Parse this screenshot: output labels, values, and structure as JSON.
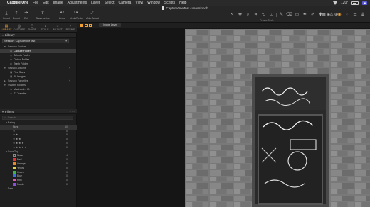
{
  "menubar": {
    "app": "Capture One",
    "items": [
      "File",
      "Edit",
      "Image",
      "Adjustments",
      "Layer",
      "Select",
      "Camera",
      "View",
      "Window",
      "Scripts",
      "Help"
    ],
    "user_badge": "",
    "battery": "120°"
  },
  "toolbar": {
    "document_title": "CaptureOneTest.cosessiondb",
    "left_tools": [
      {
        "label": "Import",
        "icon": "import-icon"
      },
      {
        "label": "Export",
        "icon": "export-icon"
      },
      {
        "label": "Exit",
        "icon": "exit-icon"
      },
      {
        "label": "Share online",
        "icon": "share-icon"
      },
      {
        "label": "Undo",
        "icon": "undo-icon"
      },
      {
        "label": "Undo/Redo",
        "icon": "redo-icon"
      },
      {
        "label": "Auto Adjust",
        "icon": "auto-adjust-icon"
      }
    ],
    "cursor_tools_label": "Cursor Tools"
  },
  "tool_tabs": [
    {
      "label": "LIBRARY",
      "active": true
    },
    {
      "label": "CAPTURE",
      "active": false
    },
    {
      "label": "SHAPE",
      "active": false
    },
    {
      "label": "STYLE",
      "active": false
    },
    {
      "label": "ADJUST",
      "active": false
    },
    {
      "label": "REFINE",
      "active": false
    }
  ],
  "viewer": {
    "layer_label": "Image Layer"
  },
  "library": {
    "title": "Library",
    "session_label": "Session: CaptureOneTest",
    "tree": [
      {
        "type": "group",
        "label": "Session Folders"
      },
      {
        "type": "item",
        "label": "Capture Folder",
        "selected": true
      },
      {
        "type": "item",
        "label": "Selects Folder"
      },
      {
        "type": "item",
        "label": "Output Folder"
      },
      {
        "type": "item",
        "label": "Trash Folder"
      },
      {
        "type": "group",
        "label": "Session Albums"
      },
      {
        "type": "item",
        "label": "Five Stars"
      },
      {
        "type": "item",
        "label": "All Images"
      },
      {
        "type": "group",
        "label": "Session Favorites"
      },
      {
        "type": "group",
        "label": "System Folders"
      },
      {
        "type": "item",
        "label": "Macintosh HD"
      },
      {
        "type": "item",
        "label": "T7 Transfer"
      }
    ]
  },
  "filters": {
    "title": "Filters",
    "search_placeholder": "Search",
    "rating_label": "Rating",
    "ratings": [
      {
        "label": "None",
        "count": "10"
      },
      {
        "label": "★",
        "count": "0"
      },
      {
        "label": "★ ★",
        "count": "0"
      },
      {
        "label": "★ ★ ★",
        "count": "0"
      },
      {
        "label": "★ ★ ★ ★",
        "count": "0"
      },
      {
        "label": "★ ★ ★ ★ ★",
        "count": "0"
      }
    ],
    "color_tag_label": "Color Tag",
    "color_tags": [
      {
        "label": "None",
        "count": "4",
        "color": ""
      },
      {
        "label": "Red",
        "count": "0",
        "color": "#d33"
      },
      {
        "label": "Orange",
        "count": "0",
        "color": "#e8882a"
      },
      {
        "label": "Yellow",
        "count": "0",
        "color": "#e6d23a"
      },
      {
        "label": "Green",
        "count": "0",
        "color": "#3bb54a"
      },
      {
        "label": "Blue",
        "count": "0",
        "color": "#3a6fe0"
      },
      {
        "label": "Pink",
        "count": "0",
        "color": "#e056b0"
      },
      {
        "label": "Purple",
        "count": "0",
        "color": "#8a4fd8"
      }
    ],
    "date_label": "Date"
  },
  "colors": {
    "accent": "#f0a030"
  }
}
